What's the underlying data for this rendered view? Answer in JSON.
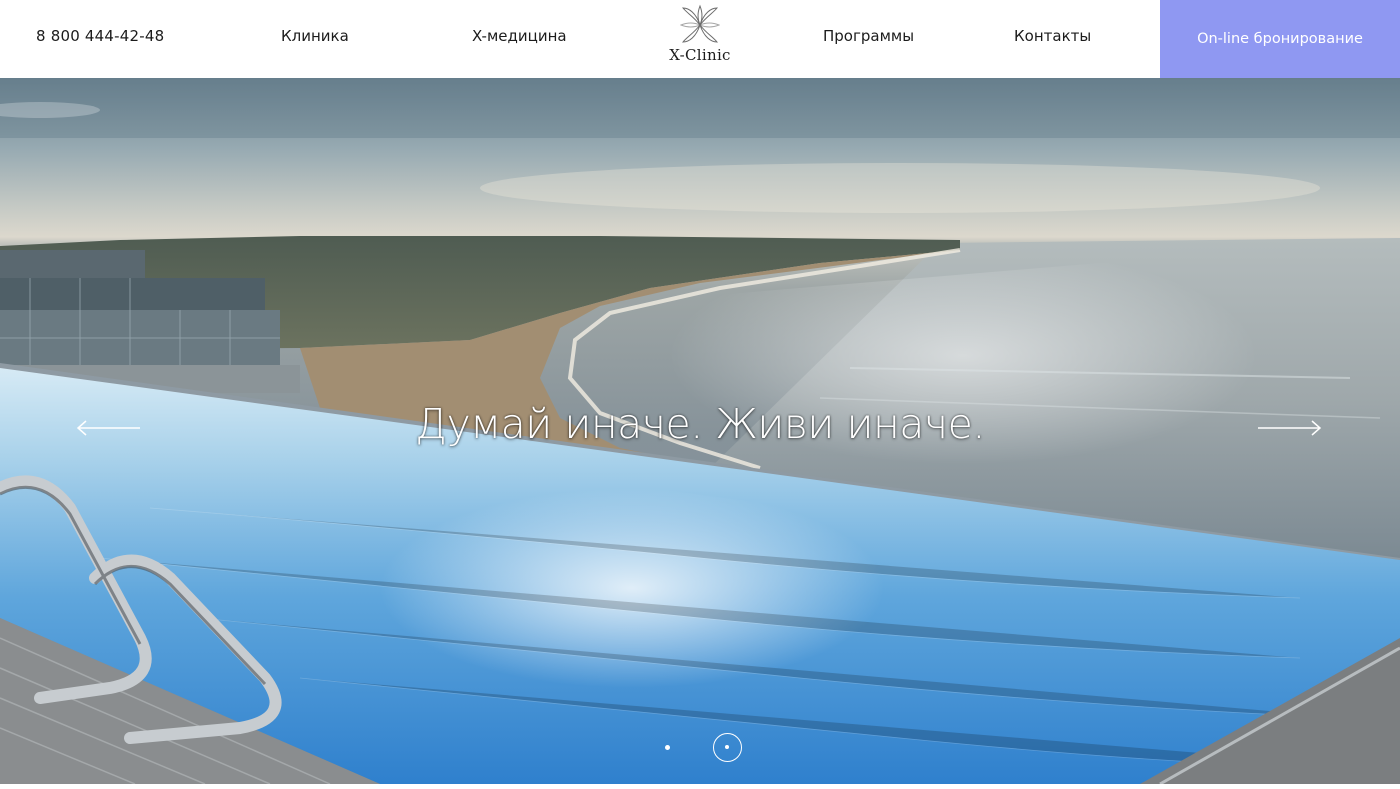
{
  "header": {
    "phone": "8 800 444-42-48",
    "nav": {
      "clinic": "Клиника",
      "x_medicine": "X-медицина",
      "programs": "Программы",
      "contacts": "Контакты"
    },
    "logo_text": "X-Clinic",
    "booking_button": "On-line бронирование"
  },
  "hero": {
    "slogan": "Думай иначе. Живи иначе.",
    "slider": {
      "slides_count": 2,
      "active_slide": 2,
      "prev_icon": "arrow-left-icon",
      "next_icon": "arrow-right-icon"
    }
  },
  "colors": {
    "accent": "#8f98f2",
    "header_bg": "#ffffff",
    "text": "#1c1c1c",
    "pool_water": "#3d8fd2"
  }
}
